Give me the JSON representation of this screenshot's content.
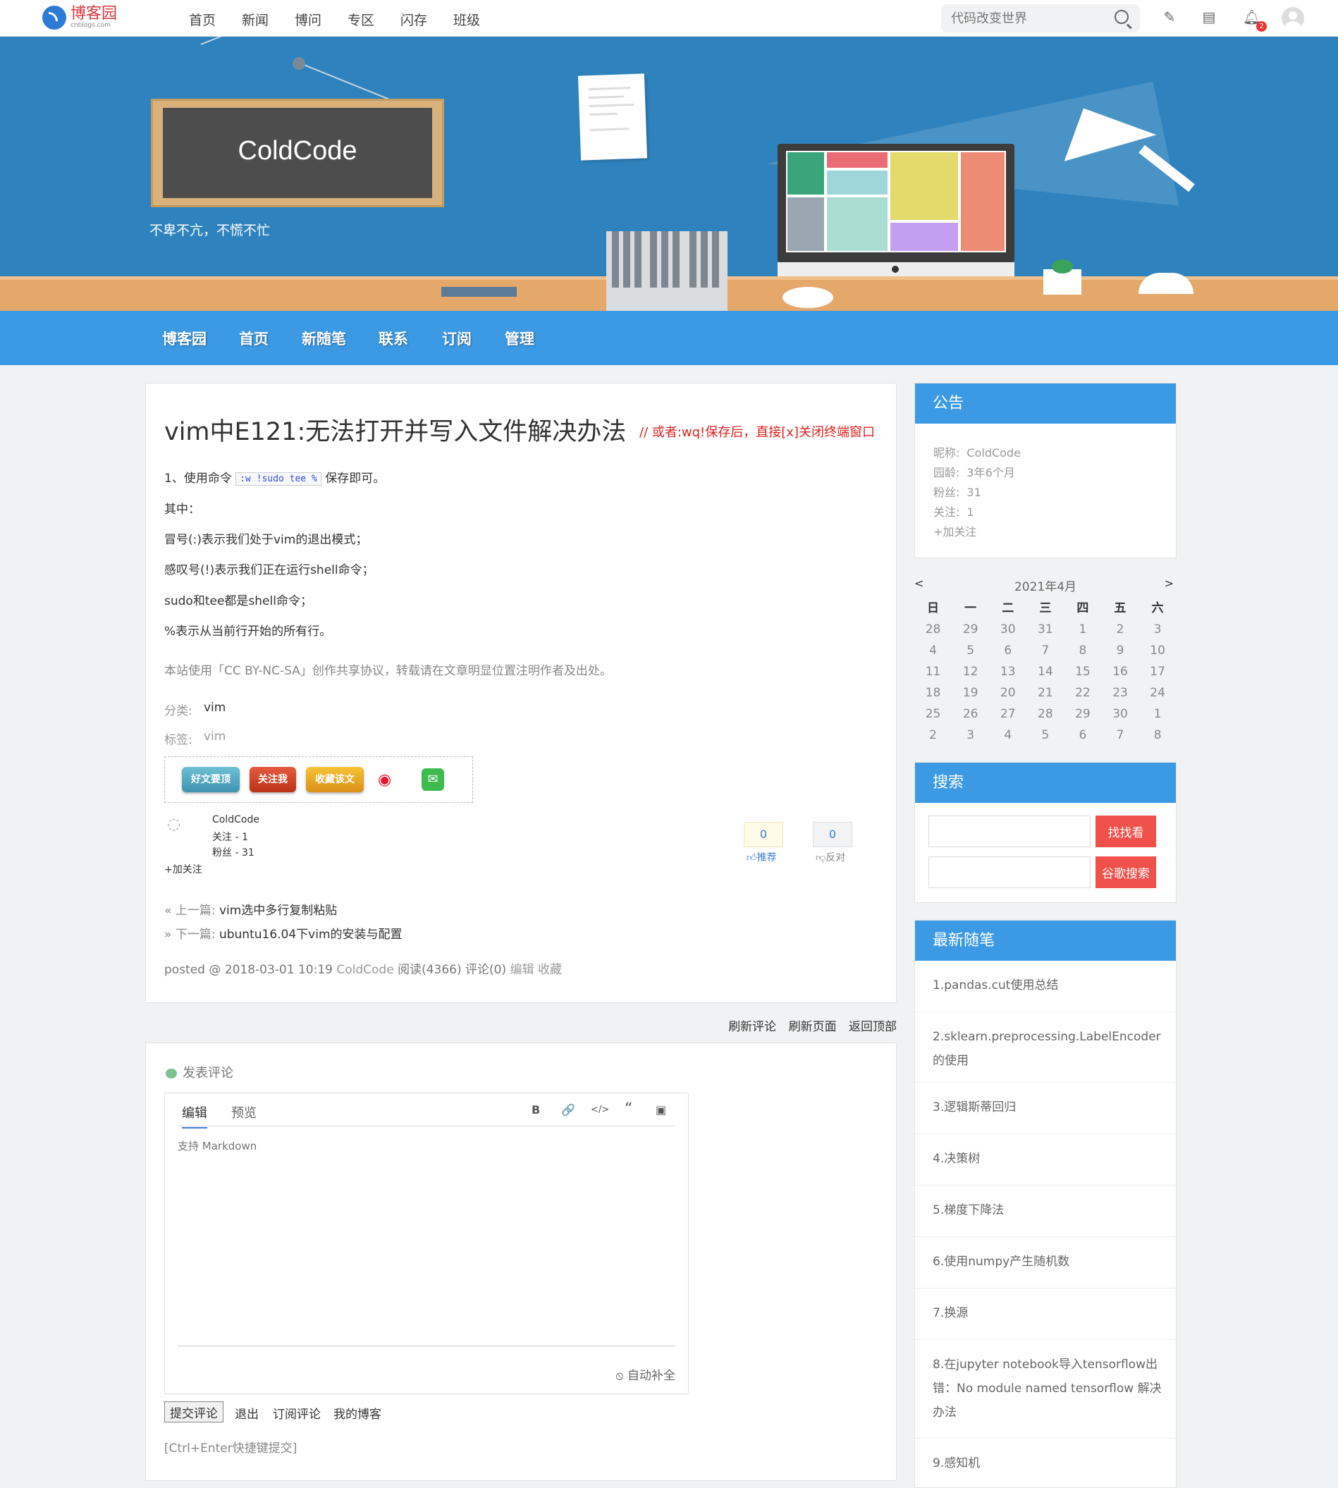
{
  "topbar": {
    "logo_text": "博客园",
    "logo_sub": "cnblogs.com",
    "nav": [
      "首页",
      "新闻",
      "博问",
      "专区",
      "闪存",
      "班级"
    ],
    "search_placeholder": "代码改变世界",
    "notification_count": "2"
  },
  "banner": {
    "blog_title": "ColdCode",
    "motto": "不卑不亢，不慌不忙"
  },
  "main_nav": [
    "博客园",
    "首页",
    "新随笔",
    "联系",
    "订阅",
    "管理"
  ],
  "post": {
    "title": "vim中E121:无法打开并写入文件解决办法",
    "note": "// 或者:wq!保存后，直接[x]关闭终端窗口",
    "line1_prefix": "1、使用命令",
    "line1_code": ":w !sudo tee %",
    "line1_suffix": "保存即可。",
    "paragraphs": [
      "其中：",
      "冒号(:)表示我们处于vim的退出模式；",
      "感叹号(!)表示我们正在运行shell命令；",
      "sudo和tee都是shell命令；",
      "%表示从当前行开始的所有行。"
    ],
    "license": "本站使用「CC BY-NC-SA」创作共享协议，转载请在文章明显位置注明作者及出处。",
    "category_label": "分类:",
    "category": "vim",
    "tag_label": "标签:",
    "tag": "vim",
    "share": {
      "good": "好文要顶",
      "follow": "关注我",
      "favorite": "收藏该文"
    },
    "author": {
      "name": "ColdCode",
      "following": "关注 - 1",
      "followers": "粉丝 - 31",
      "follow_link": "+加关注"
    },
    "votes": {
      "up": "0",
      "up_label": "推荐",
      "down": "0",
      "down_label": "反对"
    },
    "prev_label": "« 上一篇:",
    "prev_title": "vim选中多行复制粘贴",
    "next_label": "» 下一篇:",
    "next_title": "ubuntu16.04下vim的安装与配置",
    "posted_prefix": "posted @ 2018-03-01 10:19",
    "posted_author": "ColdCode",
    "reads": "阅读(4366)",
    "comments": "评论(0)",
    "edit": "编辑",
    "favorite": "收藏"
  },
  "comment_actions": [
    "刷新评论",
    "刷新页面",
    "返回顶部"
  ],
  "comment_form": {
    "heading": "发表评论",
    "tab_edit": "编辑",
    "tab_preview": "预览",
    "toolbar": [
      "B",
      "🔗",
      "</>",
      "“",
      "▣"
    ],
    "placeholder": "支持 Markdown",
    "autocomplete": "自动补全",
    "submit": "提交评论",
    "links": [
      "退出",
      "订阅评论",
      "我的博客"
    ],
    "shortcut_tip": "[Ctrl+Enter快捷键提交]"
  },
  "notice": {
    "title": "公告",
    "lines": [
      {
        "k": "昵称:",
        "v": "ColdCode"
      },
      {
        "k": "园龄:",
        "v": "3年6个月"
      },
      {
        "k": "粉丝:",
        "v": "31"
      },
      {
        "k": "关注:",
        "v": "1"
      }
    ],
    "follow": "+加关注"
  },
  "calendar": {
    "title": "2021年4月",
    "prev": "<",
    "next": ">",
    "weekdays": [
      "日",
      "一",
      "二",
      "三",
      "四",
      "五",
      "六"
    ],
    "weeks": [
      [
        "28",
        "29",
        "30",
        "31",
        "1",
        "2",
        "3"
      ],
      [
        "4",
        "5",
        "6",
        "7",
        "8",
        "9",
        "10"
      ],
      [
        "11",
        "12",
        "13",
        "14",
        "15",
        "16",
        "17"
      ],
      [
        "18",
        "19",
        "20",
        "21",
        "22",
        "23",
        "24"
      ],
      [
        "25",
        "26",
        "27",
        "28",
        "29",
        "30",
        "1"
      ],
      [
        "2",
        "3",
        "4",
        "5",
        "6",
        "7",
        "8"
      ]
    ]
  },
  "search": {
    "title": "搜索",
    "button1": "找找看",
    "button2": "谷歌搜索"
  },
  "recent": {
    "title": "最新随笔",
    "items": [
      "1.pandas.cut使用总结",
      "2.sklearn.preprocessing.LabelEncoder的使用",
      "3.逻辑斯蒂回归",
      "4.决策树",
      "5.梯度下降法",
      "6.使用numpy产生随机数",
      "7.换源",
      "8.在jupyter notebook导入tensorflow出错：No module named tensorflow 解决办法",
      "9.感知机"
    ]
  }
}
